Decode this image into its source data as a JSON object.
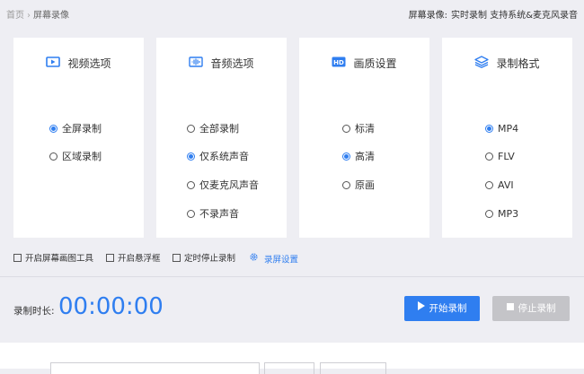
{
  "breadcrumb": {
    "home": "首页",
    "separator": "›",
    "current": "屏幕录像"
  },
  "topright": {
    "prefix": "屏幕录像:",
    "info": "实时录制 支持系统&麦克风录音"
  },
  "cards": [
    {
      "title": "视频选项",
      "icon": "video-icon",
      "options": [
        {
          "label": "全屏录制",
          "selected": true
        },
        {
          "label": "区域录制",
          "selected": false
        }
      ]
    },
    {
      "title": "音频选项",
      "icon": "audio-icon",
      "options": [
        {
          "label": "全部录制",
          "selected": false
        },
        {
          "label": "仅系统声音",
          "selected": true
        },
        {
          "label": "仅麦克风声音",
          "selected": false
        },
        {
          "label": "不录声音",
          "selected": false
        }
      ]
    },
    {
      "title": "画质设置",
      "icon": "hd-icon",
      "options": [
        {
          "label": "标清",
          "selected": false
        },
        {
          "label": "高清",
          "selected": true
        },
        {
          "label": "原画",
          "selected": false
        }
      ]
    },
    {
      "title": "录制格式",
      "icon": "layers-icon",
      "options": [
        {
          "label": "MP4",
          "selected": true
        },
        {
          "label": "FLV",
          "selected": false
        },
        {
          "label": "AVI",
          "selected": false
        },
        {
          "label": "MP3",
          "selected": false
        }
      ]
    }
  ],
  "checkboxes": [
    {
      "label": "开启屏幕画图工具",
      "checked": false
    },
    {
      "label": "开启悬浮框",
      "checked": false
    },
    {
      "label": "定时停止录制",
      "checked": false
    }
  ],
  "settings_link": "录屏设置",
  "duration": {
    "label": "录制时长:",
    "value": "00:00:00"
  },
  "buttons": {
    "start": "开始录制",
    "stop": "停止录制"
  },
  "colors": {
    "accent": "#2f7ef0",
    "disabled": "#c4c4c8",
    "background": "#eeeef3"
  }
}
